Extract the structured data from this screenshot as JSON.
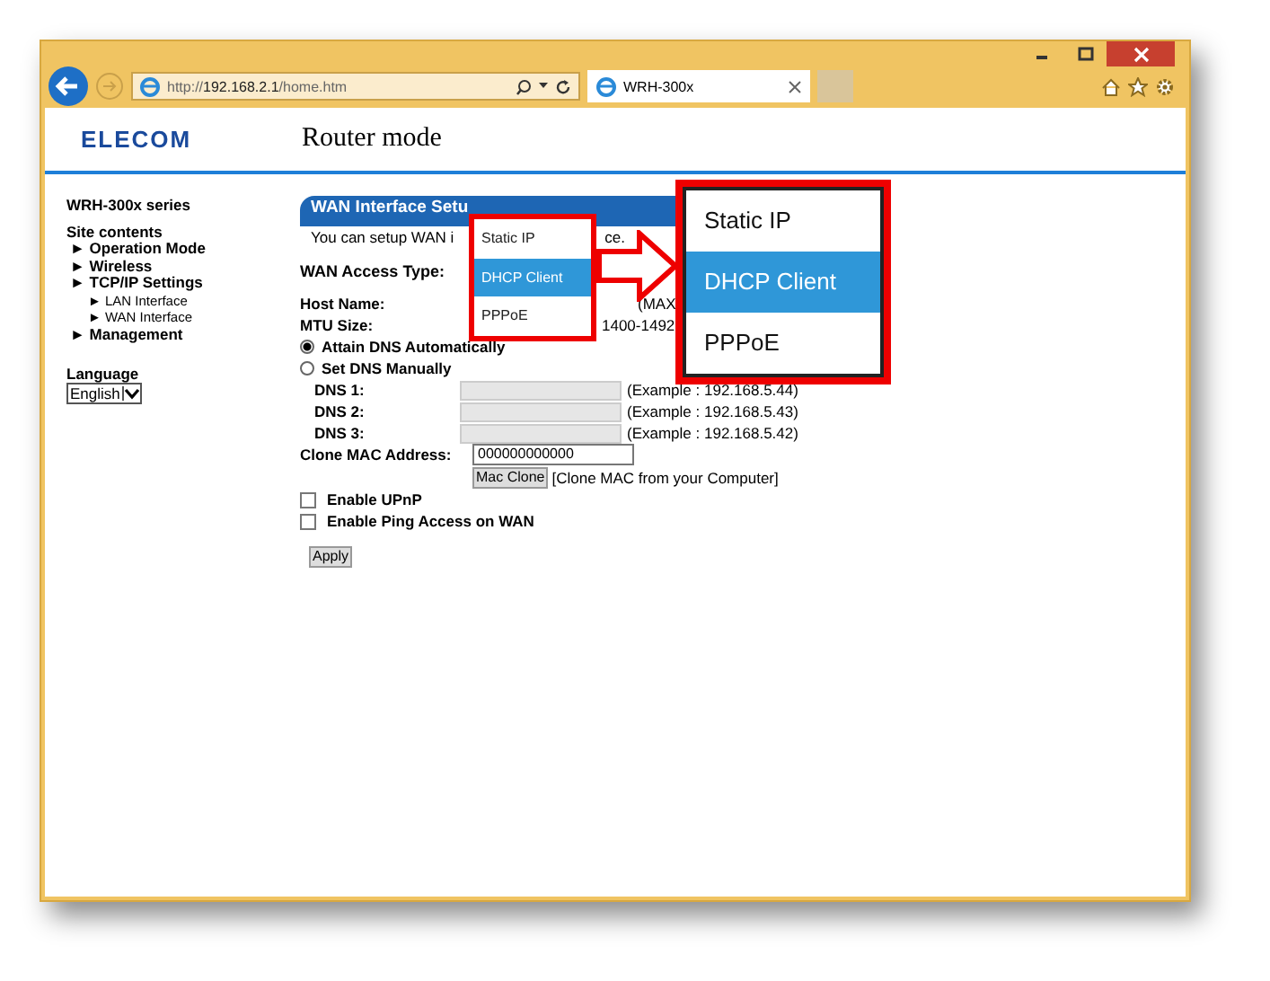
{
  "browser": {
    "address": "http://**192.168.2.1**/home.htm",
    "tab_title": "WRH-300x"
  },
  "header": {
    "logo": "ELECOM",
    "title": "Router mode"
  },
  "sidebar": {
    "series": "WRH-300x series",
    "heading": "Site contents",
    "items": [
      {
        "bullet": "►",
        "label": "Operation Mode"
      },
      {
        "bullet": "►",
        "label": "Wireless"
      },
      {
        "bullet": "►",
        "label": "TCP/IP Settings",
        "children": [
          {
            "bullet": "►",
            "label": "LAN Interface"
          },
          {
            "bullet": "►",
            "label": "WAN Interface"
          }
        ]
      },
      {
        "bullet": "►",
        "label": "Management"
      }
    ],
    "language_label": "Language",
    "language_value": "English"
  },
  "form": {
    "title": "WAN Interface Setu",
    "intro_start": "You can setup WAN i",
    "intro_end": "ce.",
    "access_type_label": "WAN Access Type:",
    "host_label": "Host Name:",
    "host_hint": "(MAX",
    "mtu_label": "MTU Size:",
    "mtu_hint": "1400-1492",
    "dns_options": [
      {
        "label": "Attain DNS Automatically",
        "selected": true
      },
      {
        "label": "Set DNS Manually",
        "selected": false
      }
    ],
    "dns_fields": [
      {
        "label": "DNS 1:",
        "hint": "(Example : 192.168.5.44)"
      },
      {
        "label": "DNS 2:",
        "hint": "(Example : 192.168.5.43)"
      },
      {
        "label": "DNS 3:",
        "hint": "(Example : 192.168.5.42)"
      }
    ],
    "clone_label": "Clone MAC Address:",
    "clone_value": "000000000000",
    "clone_button": "Mac Clone",
    "clone_hint": "[Clone MAC from your Computer]",
    "checkboxes": [
      {
        "label": "Enable UPnP",
        "checked": false
      },
      {
        "label": "Enable Ping Access on WAN",
        "checked": false
      }
    ],
    "apply": "Apply"
  },
  "dropdown": {
    "options": [
      {
        "label": "Static IP",
        "selected": false
      },
      {
        "label": "DHCP Client",
        "selected": true
      },
      {
        "label": "PPPoE",
        "selected": false
      }
    ]
  },
  "callout": {
    "options": [
      {
        "label": "Static IP",
        "selected": false
      },
      {
        "label": "DHCP Client",
        "selected": true
      },
      {
        "label": "PPPoE",
        "selected": false
      }
    ]
  }
}
